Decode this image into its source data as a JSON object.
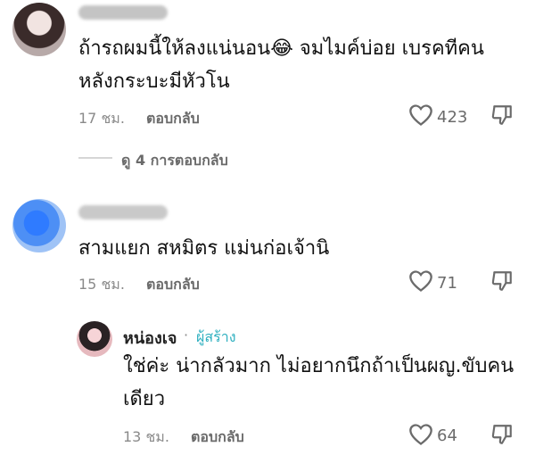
{
  "comments": [
    {
      "text_line1": "ถ้ารถผมนี้ให้ลงแน่นอน😂 จมไมค์บ่อย เบรคทีคน",
      "text_line2": "หลังกระบะมีหัวโน",
      "time": "17 ชม.",
      "reply_label": "ตอบกลับ",
      "likes": "423"
    },
    {
      "text_line1": "สามแยก สหมิตร แม่นก่อเจ้านิ",
      "time": "15 ชม.",
      "reply_label": "ตอบกลับ",
      "likes": "71"
    }
  ],
  "view_replies": "ดู 4 การตอบกลับ",
  "creator_reply": {
    "name": "หน่องเจ",
    "separator": "·",
    "tag": "ผู้สร้าง",
    "text_line1": "ใช่ค่ะ น่ากลัวมาก ไม่อยากนึกถ้าเป็นผญ.ขับคน",
    "text_line2": "เดียว",
    "time": "13 ชม.",
    "reply_label": "ตอบกลับ",
    "likes": "64"
  },
  "icons": {
    "like": "heart-outline-icon",
    "dislike": "thumbs-down-outline-icon"
  },
  "colors": {
    "creator_tag": "#2fb0c0",
    "meta_text": "#8a8a8a"
  }
}
